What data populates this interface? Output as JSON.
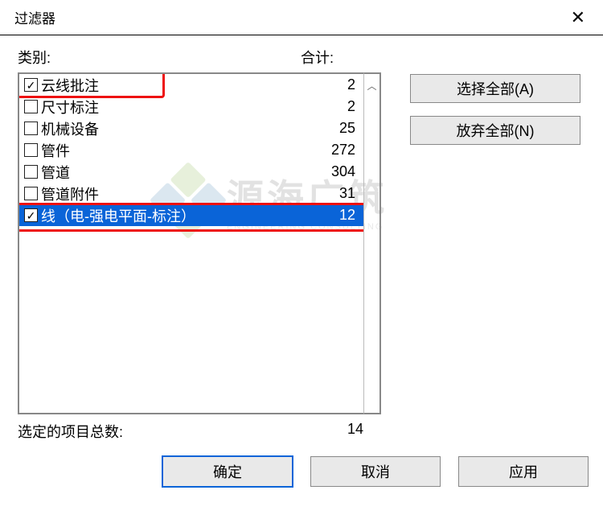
{
  "title": "过滤器",
  "headers": {
    "category": "类别:",
    "total": "合计:"
  },
  "items": [
    {
      "label": "云线批注",
      "count": 2,
      "checked": true,
      "selected": false,
      "highlight": true
    },
    {
      "label": "尺寸标注",
      "count": 2,
      "checked": false,
      "selected": false
    },
    {
      "label": "机械设备",
      "count": 25,
      "checked": false,
      "selected": false
    },
    {
      "label": "管件",
      "count": 272,
      "checked": false,
      "selected": false
    },
    {
      "label": "管道",
      "count": 304,
      "checked": false,
      "selected": false
    },
    {
      "label": "管道附件",
      "count": 31,
      "checked": false,
      "selected": false
    },
    {
      "label": "线（电-强电平面-标注）",
      "count": 12,
      "checked": true,
      "selected": true,
      "highlight": true
    }
  ],
  "side": {
    "select_all": "选择全部(A)",
    "deselect_all": "放弃全部(N)"
  },
  "footer": {
    "label": "选定的项目总数:",
    "value": 14
  },
  "actions": {
    "ok": "确定",
    "cancel": "取消",
    "apply": "应用"
  },
  "watermark": {
    "cn": "源海广筑",
    "en": "ENGINEERING CONSULTING"
  }
}
